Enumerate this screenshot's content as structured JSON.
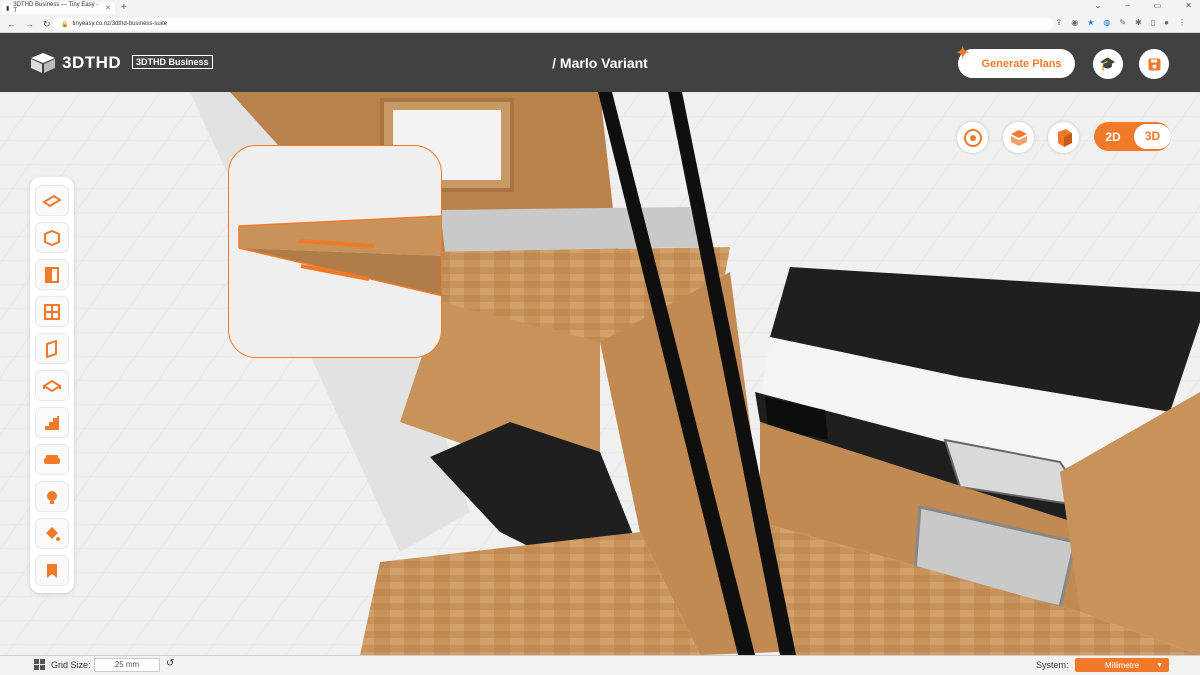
{
  "browser": {
    "tab_title": "3DTHD Business — Tiny Easy - T",
    "url": "tinyeasy.co.nz/3dthd-business-suite",
    "new_tab": "+",
    "win_min": "⌄",
    "win_minimize": "–",
    "win_max": "▭",
    "win_close": "✕"
  },
  "header": {
    "logo": "3DTHD",
    "badge": "3DTHD Business",
    "title": "/ Marlo Variant",
    "generate_label": "Generate Plans"
  },
  "toolbar_right": {
    "mode_2d": "2D",
    "mode_3d": "3D",
    "active_mode": "3D"
  },
  "sidebar": {
    "tools": [
      "floor-icon",
      "walls-icon",
      "doors-icon",
      "windows-icon",
      "panels-icon",
      "roof-icon",
      "stairs-icon",
      "furniture-icon",
      "lighting-icon",
      "paint-icon",
      "bookmark-icon"
    ]
  },
  "footer": {
    "grid_label": "Grid Size:",
    "grid_value": "25 mm",
    "system_label": "System:",
    "system_value": "Millimetre"
  },
  "colors": {
    "accent": "#f07a2a",
    "header": "#414141",
    "wood": "#c8935a",
    "dark": "#1f1f1f"
  }
}
